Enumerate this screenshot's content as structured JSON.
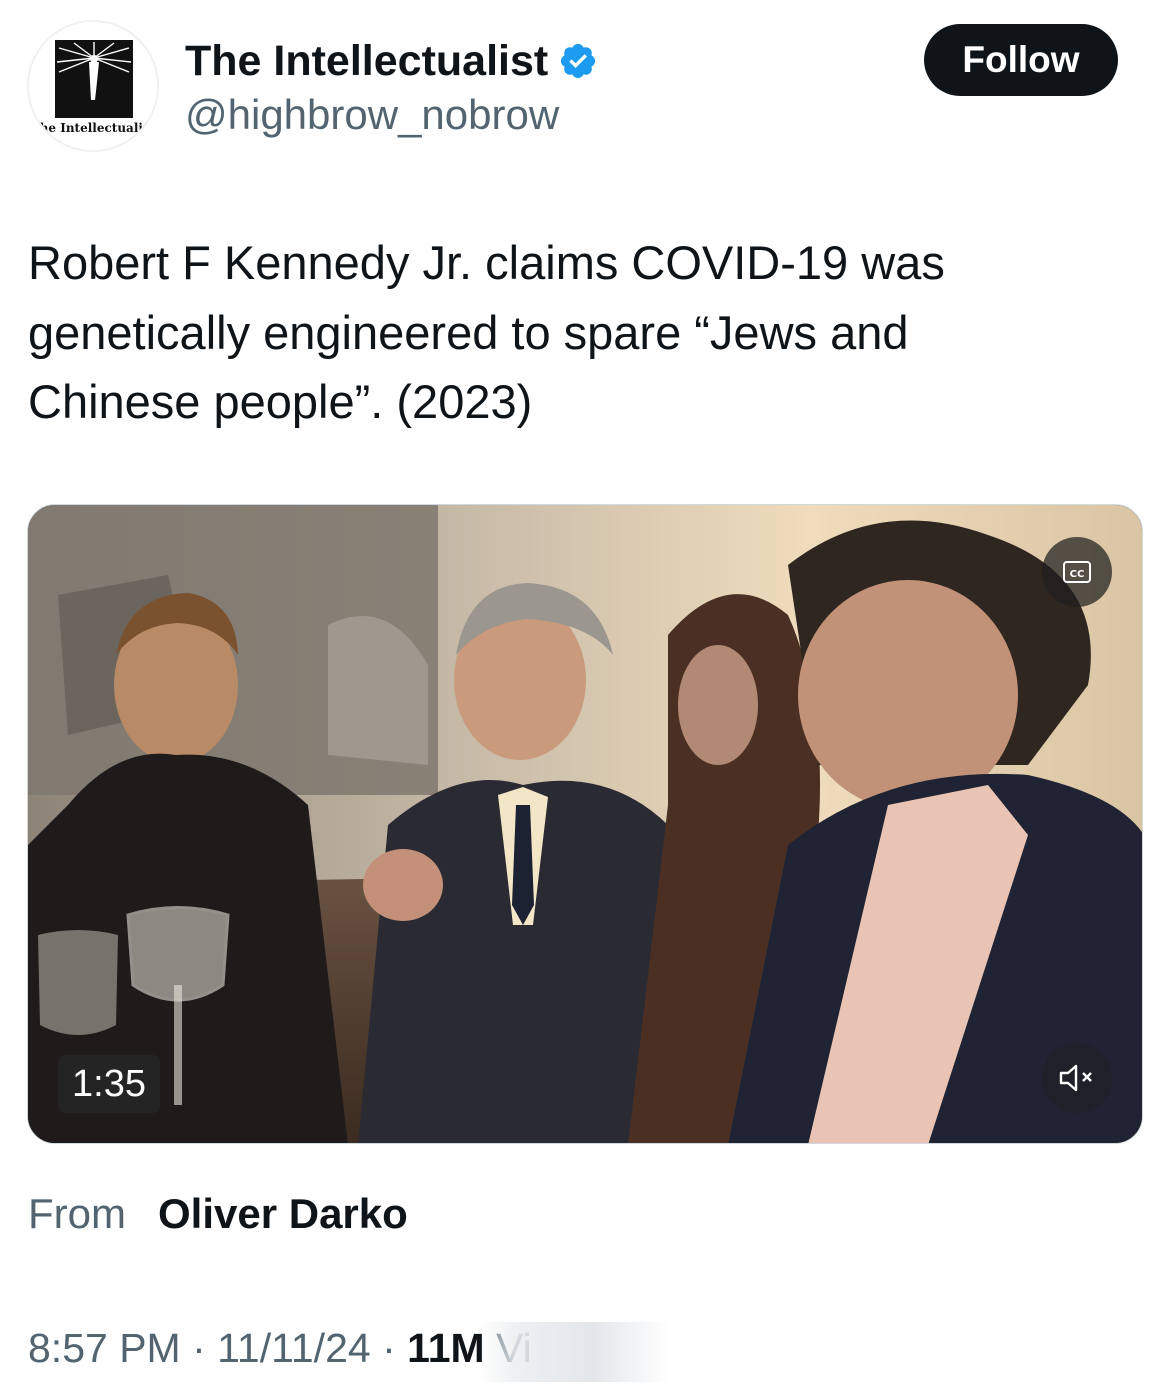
{
  "author": {
    "display_name": "The Intellectualist",
    "handle": "@highbrow_nobrow",
    "verified": true,
    "verified_color": "#1d9bf0",
    "avatar_text": "The Intellectualist"
  },
  "follow_button": {
    "label": "Follow",
    "bg_color": "#0f1419"
  },
  "tweet": {
    "text": "Robert F Kennedy Jr. claims COVID-19 was\ngenetically engineered to spare “Jews and\nChinese people”. (2023)"
  },
  "media": {
    "type": "video",
    "duration": "1:35",
    "cc_icon": "closed-captions-icon",
    "mute_icon": "volume-muted-icon"
  },
  "source": {
    "from_label": "From",
    "from_name": "Oliver Darko"
  },
  "meta": {
    "time": "8:57 PM",
    "separator": "·",
    "date": "11/11/24",
    "views_count": "11M",
    "views_label": "Vi"
  }
}
